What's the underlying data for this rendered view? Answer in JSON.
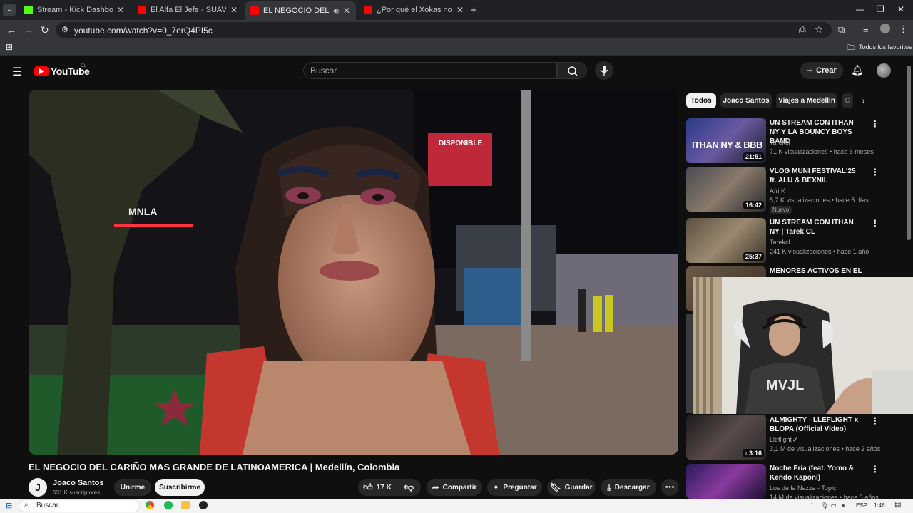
{
  "browser": {
    "tabs": [
      {
        "title": "Stream - Kick Dashboard",
        "favicon_color": "#53fc18"
      },
      {
        "title": "El Alfa El Jefe - SUAVE (Remix) f",
        "favicon_color": "#ff0000"
      },
      {
        "title": "EL NEGOCIO DEL CARIÑO M",
        "favicon_color": "#ff0000"
      },
      {
        "title": "¿Por qué el Xokas no sube de e",
        "favicon_color": "#ff0000"
      }
    ],
    "url": "youtube.com/watch?v=0_7erQ4PI5c",
    "bookmarks_folder": "Todos los favoritos"
  },
  "youtube": {
    "logo_text": "YouTube",
    "country_code": "CL",
    "search_placeholder": "Buscar",
    "create_label": "Crear"
  },
  "video": {
    "title": "EL NEGOCIO DEL CARIÑO MAS GRANDE DE LATINOAMERICA | Medellín, Colombia",
    "channel": {
      "name": "Joaco Santos",
      "avatar_letter": "J",
      "subscribers": "631 K suscriptores"
    },
    "join_label": "Unirme",
    "subscribe_label": "Suscribirme",
    "likes": "17 K",
    "share_label": "Compartir",
    "ask_label": "Preguntar",
    "save_label": "Guardar",
    "download_label": "Descargar",
    "scene_text": {
      "sign_left": "MNLA",
      "billboard": "DISPONIBLE"
    }
  },
  "chips": [
    "Todos",
    "Joaco Santos",
    "Viajes a Medellin",
    "C"
  ],
  "related": [
    {
      "title": "UN STREAM CON ITHAN NY Y LA BOUNCY BOYS BAND",
      "channel": "Tarekcl",
      "meta": "71 K visualizaciones • hace 6 meses",
      "duration": "21:51",
      "thumb_text": "ITHAN NY & BBB"
    },
    {
      "title": "VLOG MUNI FESTIVAL'25 ft. ALU & BEXNIL",
      "channel": "Afri K",
      "meta": "5,7 K visualizaciones • hace 5 días",
      "duration": "16:42",
      "badge": "Nuevo"
    },
    {
      "title": "UN STREAM CON ITHAN NY | Tarek CL",
      "channel": "Tarekcl",
      "meta": "241 K visualizaciones • hace 1 año",
      "duration": "25:37"
    },
    {
      "title": "MENORES ACTIVOS EN EL",
      "channel": "",
      "meta": "",
      "duration": ""
    },
    {
      "title": "ALMIGHTY - LLEFLIGHT x BLOPA (Official Video)",
      "channel": "Lleflight",
      "meta": "3,1 M de visualizaciones • hace 2 años",
      "duration": "3:16"
    },
    {
      "title": "Noche Fría (feat. Yomo & Kendo Kaponi)",
      "channel": "Los de la Nazza - Topic",
      "meta": "14 M de visualizaciones • hace 5 años",
      "duration": ""
    }
  ],
  "webcam": {
    "shirt_text": "MVJL"
  },
  "taskbar": {
    "search_label": "Buscar",
    "lang": "ESP",
    "time": "1:46"
  }
}
